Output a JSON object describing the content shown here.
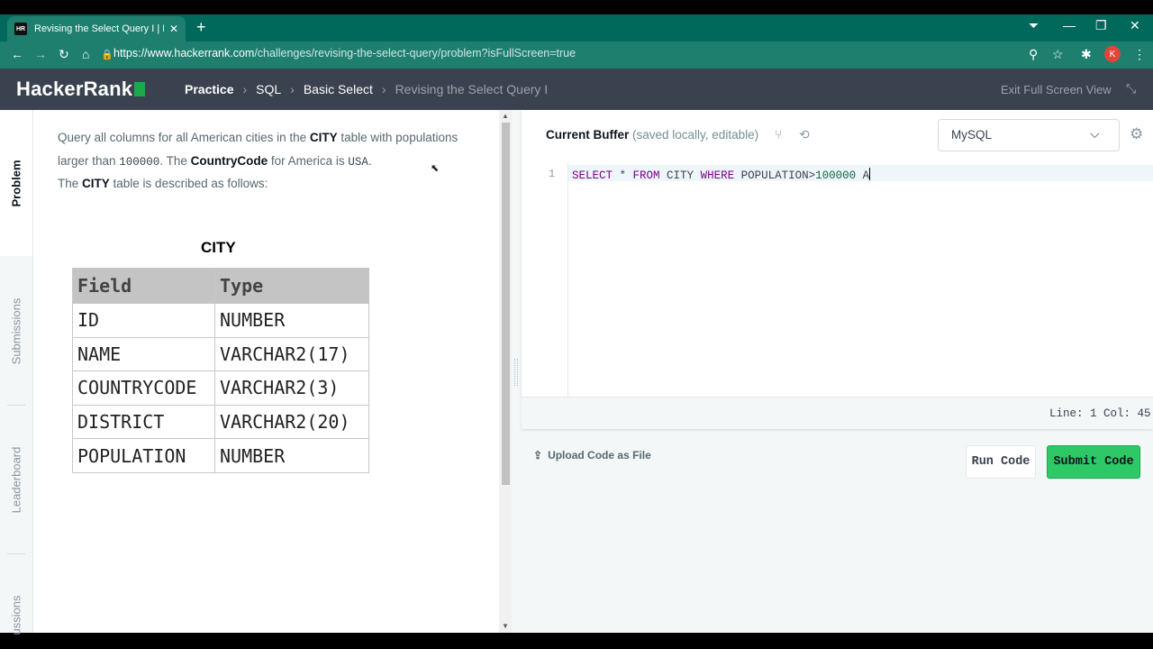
{
  "browser": {
    "tab_title": "Revising the Select Query I | Hac",
    "tab_favicon": "HR",
    "url_host": "https://www.hackerrank.com",
    "url_path": "/challenges/revising-the-select-query/problem?isFullScreen=true",
    "profile_initial": "K"
  },
  "header": {
    "logo": "HackerRank",
    "breadcrumb": [
      "Practice",
      "SQL",
      "Basic Select",
      "Revising the Select Query I"
    ],
    "exit_fullscreen": "Exit Full Screen View"
  },
  "sidebar_tabs": [
    "Problem",
    "Submissions",
    "Leaderboard",
    "ussions"
  ],
  "problem": {
    "p1_a": "Query all columns for all American cities in the ",
    "p1_city": "CITY",
    "p1_b": " table with populations larger than ",
    "p1_num": "100000",
    "p1_c": ". The ",
    "p1_cc": "CountryCode",
    "p1_d": " for America is ",
    "p1_usa": "USA",
    "p1_e": ".",
    "p2_a": "The ",
    "p2_city": "CITY",
    "p2_b": " table is described as follows:",
    "table_caption": "CITY",
    "table_headers": [
      "Field",
      "Type"
    ],
    "table_rows": [
      [
        "ID",
        "NUMBER"
      ],
      [
        "NAME",
        "VARCHAR2(17)"
      ],
      [
        "COUNTRYCODE",
        "VARCHAR2(3)"
      ],
      [
        "DISTRICT",
        "VARCHAR2(20)"
      ],
      [
        "POPULATION",
        "NUMBER"
      ]
    ]
  },
  "editor": {
    "buffer_title": "Current Buffer",
    "buffer_sub": " (saved locally, editable)",
    "language": "MySQL",
    "line_number": "1",
    "code_tokens": {
      "select": "SELECT",
      "star": " * ",
      "from": "FROM",
      "city": " CITY ",
      "where": "WHERE",
      "pop": " POPULATION>",
      "num": "100000",
      "tail": " A"
    },
    "status": "Line: 1 Col: 45",
    "upload_label": "Upload Code as File",
    "run_label": "Run Code",
    "submit_label": "Submit Code"
  },
  "colors": {
    "brand_green": "#1ba94c",
    "header_bg": "#39424e",
    "submit_bg": "#2ec866",
    "chrome_teal": "#00695c"
  }
}
